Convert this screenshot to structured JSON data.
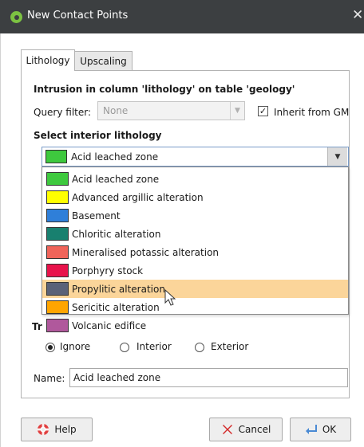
{
  "window": {
    "title": "New Contact Points"
  },
  "tabs": [
    {
      "label": "Lithology",
      "active": true
    },
    {
      "label": "Upscaling",
      "active": false
    }
  ],
  "intrusion_title": "Intrusion in column 'lithology' on table 'geology'",
  "query_filter": {
    "label": "Query filter:",
    "value": "None",
    "disabled": true
  },
  "inherit": {
    "label": "Inherit from GM",
    "checked": true
  },
  "interior": {
    "title": "Select interior lithology",
    "selected": {
      "label": "Acid leached zone",
      "color": "#3ec93e"
    },
    "options": [
      {
        "label": "Acid leached zone",
        "color": "#3ec93e"
      },
      {
        "label": "Advanced argillic alteration",
        "color": "#ffff00"
      },
      {
        "label": "Basement",
        "color": "#2f7fd9"
      },
      {
        "label": "Chloritic alteration",
        "color": "#18806f"
      },
      {
        "label": "Mineralised potassic alteration",
        "color": "#f0645a"
      },
      {
        "label": "Porphyry stock",
        "color": "#e8134b"
      },
      {
        "label": "Propylitic alteration",
        "color": "#5a6278"
      },
      {
        "label": "Sericitic alteration",
        "color": "#ffa500"
      },
      {
        "label": "Volcanic edifice",
        "color": "#b0589c"
      }
    ],
    "hovered_index": 6
  },
  "trim": {
    "label": "Tr",
    "options": [
      {
        "label": "Ignore",
        "selected": true
      },
      {
        "label": "Interior",
        "selected": false
      },
      {
        "label": "Exterior",
        "selected": false
      }
    ]
  },
  "name": {
    "label": "Name:",
    "value": "Acid leached zone"
  },
  "buttons": {
    "help": "Help",
    "cancel": "Cancel",
    "ok": "OK"
  },
  "colors": {
    "titlebar": "#3c3f41",
    "hover": "#fbd59a",
    "combo_border": "#7a9cc8"
  }
}
